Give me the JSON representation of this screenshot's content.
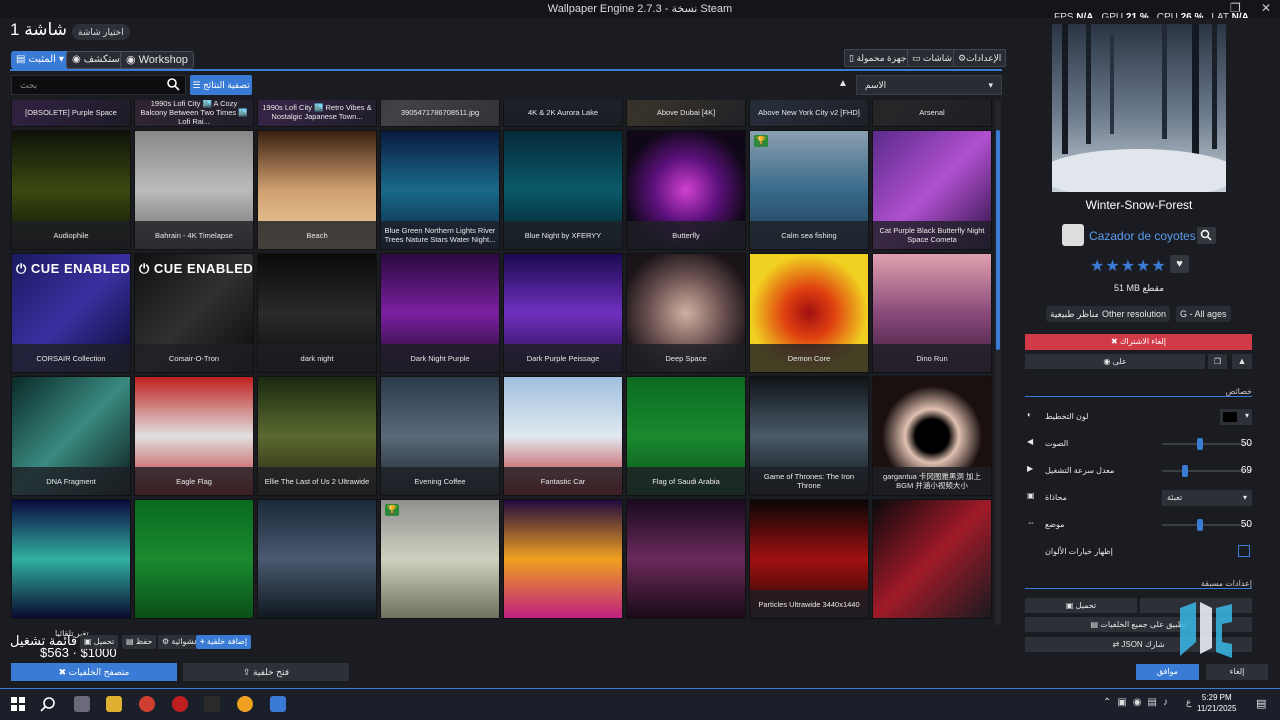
{
  "window": {
    "title": "Wallpaper Engine 2.7.3 - نسخة Steam"
  },
  "performance": {
    "fps_label": "FPS",
    "fps": "N/A",
    "gpu_label": "GPU",
    "gpu": "21 %",
    "cpu_label": "CPU",
    "cpu": "26 %",
    "lat_label": "LAT",
    "lat": "N/A"
  },
  "header": {
    "screen_title": "شاشة 1",
    "change_screen": "اختيار شاشة"
  },
  "tabs": [
    {
      "label": "المثبت"
    },
    {
      "label": "استكشف"
    },
    {
      "label": "Workshop"
    }
  ],
  "top_buttons": {
    "settings": "الإعدادات",
    "screens": "شاشات",
    "portable": "أجهزة محمولة"
  },
  "search": {
    "placeholder": "بحث"
  },
  "filter_button": "تصفية النتائج",
  "sort": {
    "value": "الاسم"
  },
  "grid": [
    {
      "name": "[OBSOLETE] Purple Space",
      "bg": "linear-gradient(135deg,#3a0e5a,#7a2ab0,#1a0830)"
    },
    {
      "name": "1990s Lofi City 🏙️ A Cozy Balcony Between Two Times 🏙️ Lofi Rai...",
      "bg": "linear-gradient(135deg,#2b1e44,#7a3a6a,#1e1a3a)"
    },
    {
      "name": "1990s Lofi City 🏙️ Retro Vibes & Nostalgic Japanese Town...",
      "bg": "linear-gradient(135deg,#3a1a60,#9a3ad0,#22143e)"
    },
    {
      "name": "3905471786708511.jpg",
      "bg": "linear-gradient(135deg,#666,#ddd,#888)"
    },
    {
      "name": "4K & 2K Aurora Lake",
      "bg": "linear-gradient(180deg,#0a1a30,#1a4a6a,#0a1420)"
    },
    {
      "name": "Above Dubai [4K]",
      "bg": "linear-gradient(135deg,#4a3a20,#aa8a40,#2a2a30)",
      "overlay": "4K"
    },
    {
      "name": "Above New York City v2 [FHD]",
      "bg": "linear-gradient(135deg,#1a3050,#4a6a90,#1a2030)",
      "overlay": "FHD"
    },
    {
      "name": "Arsenal",
      "bg": "linear-gradient(135deg,#2a2820,#4a4638,#1a1a18)"
    },
    {
      "name": "Audiophile",
      "bg": "linear-gradient(180deg,#0e1208,#3a4a10,#0a0e06)"
    },
    {
      "name": "Bahrain - 4K Timelapse",
      "bg": "linear-gradient(180deg,#888,#bbb,#666)"
    },
    {
      "name": "Beach",
      "bg": "linear-gradient(180deg,#3a2010,#d0a070,#f0d0a0)"
    },
    {
      "name": "Blue Green Northern Lights River Trees Nature Stars Water Night...",
      "bg": "linear-gradient(180deg,#0a1a40,#1a6a8a,#0a2040)"
    },
    {
      "name": "Blue Night by XFERYY",
      "bg": "linear-gradient(180deg,#062a3a,#0a5a6a,#041a28)"
    },
    {
      "name": "Butterfly",
      "bg": "radial-gradient(circle at 50% 50%,#d040d0,#5a107a 40%,#100818 75%)"
    },
    {
      "name": "Calm sea fishing",
      "bg": "linear-gradient(180deg,#8aa0b0,#3a6a8a,#1a3a50)",
      "badge": true
    },
    {
      "name": "Cat Purple Black Butterfly Night Space Cometa",
      "bg": "linear-gradient(135deg,#5a2a8a,#b050d0,#2a1040)"
    },
    {
      "name": "CORSAIR Collection",
      "bg": "linear-gradient(135deg,#1a1a60,#3a30a0,#0a0a30)",
      "cue": true
    },
    {
      "name": "Corsair-O-Tron",
      "bg": "linear-gradient(135deg,#101010,#303030,#0a0a0a)",
      "cue": true
    },
    {
      "name": "dark night",
      "bg": "linear-gradient(180deg,#0a0a0a,#2a2a2a,#0a0a0a)"
    },
    {
      "name": "Dark Night Purple",
      "bg": "linear-gradient(180deg,#2a0a40,#7a20a0,#1a0a28)"
    },
    {
      "name": "Dark Purple Peissage",
      "bg": "linear-gradient(180deg,#1a0a50,#7030c0,#200a40)"
    },
    {
      "name": "Deep Space",
      "bg": "radial-gradient(circle at 50% 50%,#d0b0a0,#6a5050 45%,#1a1418 80%)"
    },
    {
      "name": "Demon Core",
      "bg": "radial-gradient(circle at 50% 50%,#a01010,#e04010 30%,#f0d020 70%)"
    },
    {
      "name": "Dino Run",
      "bg": "linear-gradient(180deg,#e0a0b0,#8a4a7a,#3a1a3a)"
    },
    {
      "name": "DNA Fragment",
      "bg": "linear-gradient(135deg,#0a2a28,#3a8a80,#0a1a18)"
    },
    {
      "name": "Eagle Flag",
      "bg": "linear-gradient(180deg,#c02020,#e0e0e0,#c02020)"
    },
    {
      "name": "Ellie The Last of Us 2 Ultrawide",
      "bg": "linear-gradient(180deg,#1a2a10,#5a6a30,#2a2010)"
    },
    {
      "name": "Evening Coffee",
      "bg": "linear-gradient(180deg,#2a3a4a,#5a6a7a,#1a2028)"
    },
    {
      "name": "Fantastic Car",
      "bg": "linear-gradient(180deg,#a0c0e0,#e0e8f0,#c02020)"
    },
    {
      "name": "Flag of Saudi Arabia",
      "bg": "linear-gradient(180deg,#0a6a20,#1a8a30,#0a5018)"
    },
    {
      "name": "Game of Thrones: The Iron Throne",
      "bg": "linear-gradient(180deg,#101418,#4a5a68,#0a0e12)"
    },
    {
      "name": "gargantua 卡冈图雅黑洞 加上BGM 并涵小视频大小",
      "bg": "radial-gradient(circle at 50% 50%,#000 20%,#e0c0b0 32%,#1a1010 60%)"
    },
    {
      "name": "",
      "bg": "linear-gradient(180deg,#0a0a40,#30b0a0,#0a0a30)"
    },
    {
      "name": "",
      "bg": "linear-gradient(180deg,#0a6a20,#1a8a30,#0a5018)"
    },
    {
      "name": "",
      "bg": "linear-gradient(180deg,#1a2a3a,#4a5a70,#101820)"
    },
    {
      "name": "",
      "bg": "linear-gradient(180deg,#909090,#d0d0c0,#707060)",
      "badge": true
    },
    {
      "name": "",
      "bg": "linear-gradient(180deg,#200a40,#f0a020,#c02080)"
    },
    {
      "name": "",
      "bg": "linear-gradient(180deg,#1a0a20,#6a2a5a,#1a0a18)"
    },
    {
      "name": "Particles Ultrawide 3440x1440",
      "bg": "linear-gradient(180deg,#0a0606,#a01010,#200606)"
    },
    {
      "name": "",
      "bg": "linear-gradient(135deg,#0a0a0c,#a01a28,#1a1a20)"
    }
  ],
  "bottom": {
    "playlist_title": "قائمة تشغيل",
    "playlist_sub": "تغير تلقائيا",
    "playlist_price": "$563 · $1000",
    "add_wallpaper": "إضافة خلفية",
    "shuffle": "عشوائية",
    "save": "حفظ",
    "load": "تحميل",
    "wallpaper_browser": "متصفح الخلفيات",
    "open_wallpaper": "فتح خلفية"
  },
  "panel": {
    "title": "Winter-Snow-Forest",
    "author": "Cazador de coyotes",
    "stars": "★★★★★",
    "size": "51 MB مقطع",
    "tags": [
      "مناظر طبيعية",
      "Other resolution",
      "G - All ages"
    ],
    "unsubscribe": "إلغاء الاشتراك",
    "on_button": "على",
    "properties_title": "خصائص",
    "props": [
      {
        "label": "لون التخطيط",
        "type": "color",
        "value": ""
      },
      {
        "label": "الصوت",
        "type": "slider",
        "value": "50",
        "frac": 0.5
      },
      {
        "label": "معدل سرعة التشغيل",
        "type": "slider",
        "value": "69",
        "frac": 0.28
      },
      {
        "label": "محاذاة",
        "type": "select",
        "value": "تعبئة"
      },
      {
        "label": "موضع",
        "type": "slider",
        "value": "50",
        "frac": 0.5
      },
      {
        "label": "إظهار خيارات الألوان",
        "type": "checkbox",
        "value": ""
      }
    ],
    "presets_title": "إعدادات مسبقة",
    "load_btn": "تحميل",
    "apply_all": "تطبيق على جميع الخلفيات",
    "share_json": "JSON شارك",
    "ok": "موافق",
    "cancel": "إلغاء"
  },
  "taskbar": {
    "time": "5:29 PM",
    "date": "11/21/2025",
    "lang": "ع"
  },
  "colors": {
    "accent": "#3a7bd5",
    "danger": "#d33a48",
    "bg": "#1b1c21"
  }
}
